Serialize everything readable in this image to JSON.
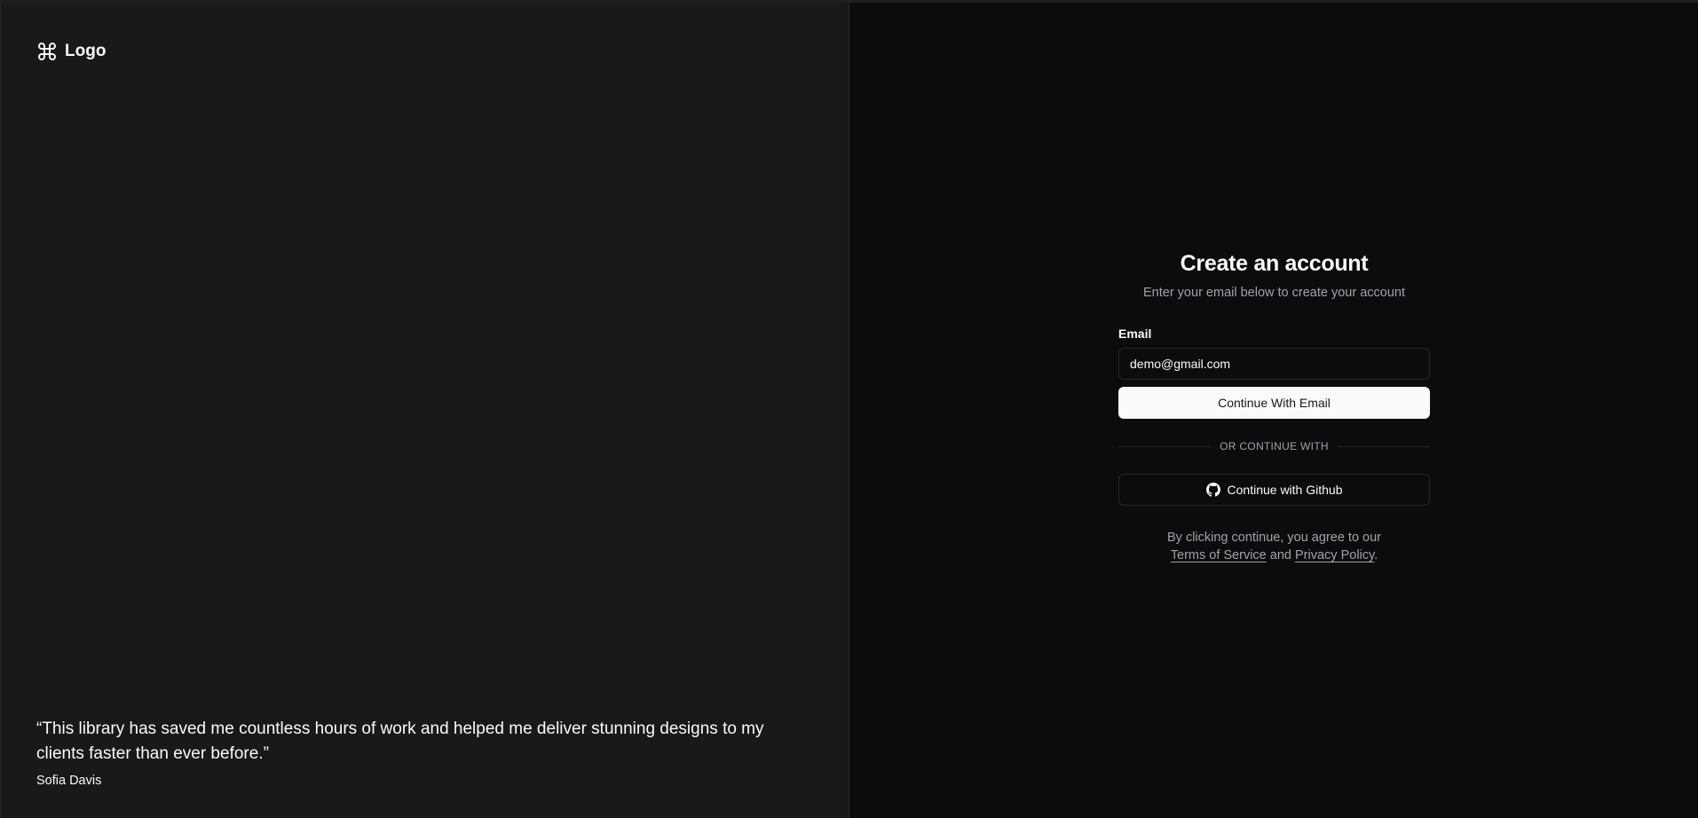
{
  "brand": {
    "logo_icon": "command-icon",
    "logo_text": "Logo"
  },
  "testimonial": {
    "quote": "“This library has saved me countless hours of work and helped me deliver stunning designs to my clients faster than ever before.”",
    "author": "Sofia Davis"
  },
  "form": {
    "title": "Create an account",
    "subtitle": "Enter your email below to create your account",
    "email_label": "Email",
    "email_value": "demo@gmail.com",
    "primary_button": "Continue With Email",
    "divider_text": "OR CONTINUE WITH",
    "github_icon": "github-icon",
    "github_button": "Continue with Github",
    "terms_prefix": "By clicking continue, you agree to our",
    "terms_link": "Terms of Service",
    "terms_and": "and",
    "privacy_link": "Privacy Policy",
    "terms_suffix": "."
  },
  "colors": {
    "left_panel_bg": "#19191c",
    "right_panel_bg": "#0c0c0e",
    "primary_button_bg": "#fafafa",
    "muted_text": "#a1a1aa",
    "border": "#27272a"
  }
}
